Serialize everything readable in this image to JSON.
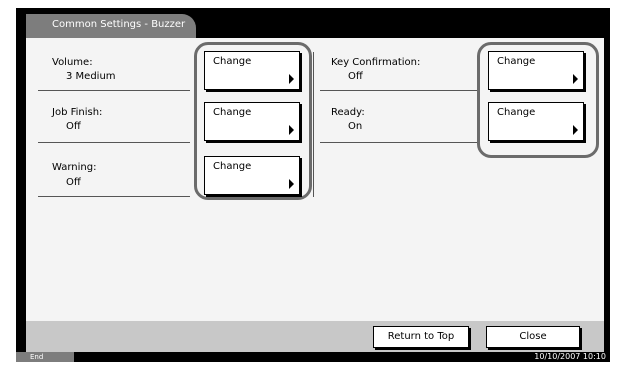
{
  "header": {
    "title": "Common Settings - Buzzer"
  },
  "settings": {
    "volume": {
      "label": "Volume:",
      "value": "3 Medium"
    },
    "job_finish": {
      "label": "Job Finish:",
      "value": "Off"
    },
    "warning": {
      "label": "Warning:",
      "value": "Off"
    },
    "key_confirmation": {
      "label": "Key Confirmation:",
      "value": "Off"
    },
    "ready": {
      "label": "Ready:",
      "value": "On"
    }
  },
  "buttons": {
    "change_label": "Change",
    "return_to_top": "Return to Top",
    "close": "Close"
  },
  "status": {
    "end": "End",
    "datetime": "10/10/2007   10:10"
  }
}
